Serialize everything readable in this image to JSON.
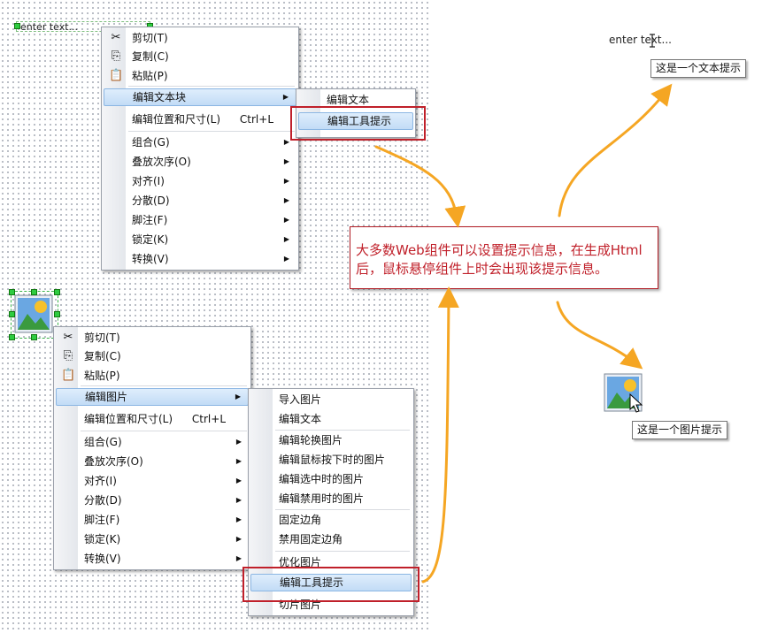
{
  "canvas": {
    "text_element": "enter text..."
  },
  "menu1": {
    "items": [
      {
        "label": "剪切(T)",
        "icon": "scissors-icon"
      },
      {
        "label": "复制(C)",
        "icon": "copy-icon"
      },
      {
        "label": "粘贴(P)",
        "icon": "paste-icon"
      },
      {
        "label": "编辑文本块"
      },
      {
        "label": "编辑位置和尺寸(L)",
        "shortcut": "Ctrl+L"
      },
      {
        "label": "组合(G)"
      },
      {
        "label": "叠放次序(O)"
      },
      {
        "label": "对齐(I)"
      },
      {
        "label": "分散(D)"
      },
      {
        "label": "脚注(F)"
      },
      {
        "label": "锁定(K)"
      },
      {
        "label": "转换(V)"
      }
    ]
  },
  "submenu1": {
    "items": [
      {
        "label": "编辑文本"
      },
      {
        "label": "编辑工具提示"
      }
    ]
  },
  "menu2": {
    "items": [
      {
        "label": "剪切(T)",
        "icon": "scissors-icon"
      },
      {
        "label": "复制(C)",
        "icon": "copy-icon"
      },
      {
        "label": "粘贴(P)",
        "icon": "paste-icon"
      },
      {
        "label": "编辑图片"
      },
      {
        "label": "编辑位置和尺寸(L)",
        "shortcut": "Ctrl+L"
      },
      {
        "label": "组合(G)"
      },
      {
        "label": "叠放次序(O)"
      },
      {
        "label": "对齐(I)"
      },
      {
        "label": "分散(D)"
      },
      {
        "label": "脚注(F)"
      },
      {
        "label": "锁定(K)"
      },
      {
        "label": "转换(V)"
      }
    ]
  },
  "submenu2": {
    "items": [
      {
        "label": "导入图片"
      },
      {
        "label": "编辑文本"
      },
      {
        "label": "编辑轮换图片"
      },
      {
        "label": "编辑鼠标按下时的图片"
      },
      {
        "label": "编辑选中时的图片"
      },
      {
        "label": "编辑禁用时的图片"
      },
      {
        "label": "固定边角"
      },
      {
        "label": "禁用固定边角"
      },
      {
        "label": "优化图片"
      },
      {
        "label": "编辑工具提示"
      },
      {
        "label": "切片图片"
      }
    ]
  },
  "annotation": {
    "text": "大多数Web组件可以设置提示信息，在生成Html后，鼠标悬停组件上时会出现该提示信息。"
  },
  "preview": {
    "text_element": "enter text...",
    "text_tooltip": "这是一个文本提示",
    "image_tooltip": "这是一个图片提示"
  },
  "colors": {
    "accent_arrow": "#f5a623",
    "highlight": "#c2dcf6",
    "annotation_red": "#c0202a"
  }
}
